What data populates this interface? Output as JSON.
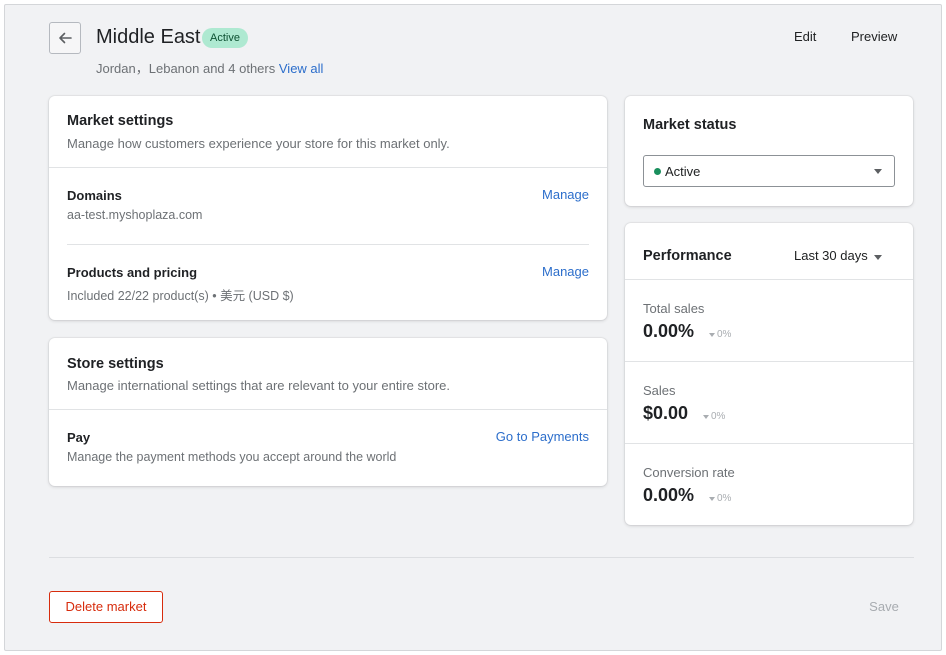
{
  "header": {
    "title": "Middle East",
    "status": "Active",
    "subtitle_regions": "Jordan，Lebanon and 4 others",
    "view_all": "View all",
    "edit": "Edit",
    "preview": "Preview"
  },
  "market_settings": {
    "title": "Market settings",
    "description": "Manage how customers experience your store for this market only.",
    "domains": {
      "title": "Domains",
      "value": "aa-test.myshoplaza.com",
      "action": "Manage"
    },
    "products": {
      "title": "Products and pricing",
      "value": "Included 22/22 product(s) • 美元 (USD $)",
      "action": "Manage"
    }
  },
  "store_settings": {
    "title": "Store settings",
    "description": "Manage international settings that are relevant to your entire store.",
    "pay": {
      "title": "Pay",
      "value": "Manage the payment methods you accept around the world",
      "action": "Go to Payments"
    }
  },
  "market_status": {
    "title": "Market status",
    "selected": "Active",
    "status_color": "#1a8f5d"
  },
  "performance": {
    "title": "Performance",
    "range": "Last 30 days",
    "metrics": [
      {
        "label": "Total sales",
        "value": "0.00%",
        "delta": "0%"
      },
      {
        "label": "Sales",
        "value": "$0.00",
        "delta": "0%"
      },
      {
        "label": "Conversion rate",
        "value": "0.00%",
        "delta": "0%"
      }
    ]
  },
  "footer": {
    "delete": "Delete market",
    "save": "Save"
  },
  "colors": {
    "link": "#2c6ecb",
    "danger": "#d72c0d",
    "badge_bg": "#aee9d1"
  }
}
